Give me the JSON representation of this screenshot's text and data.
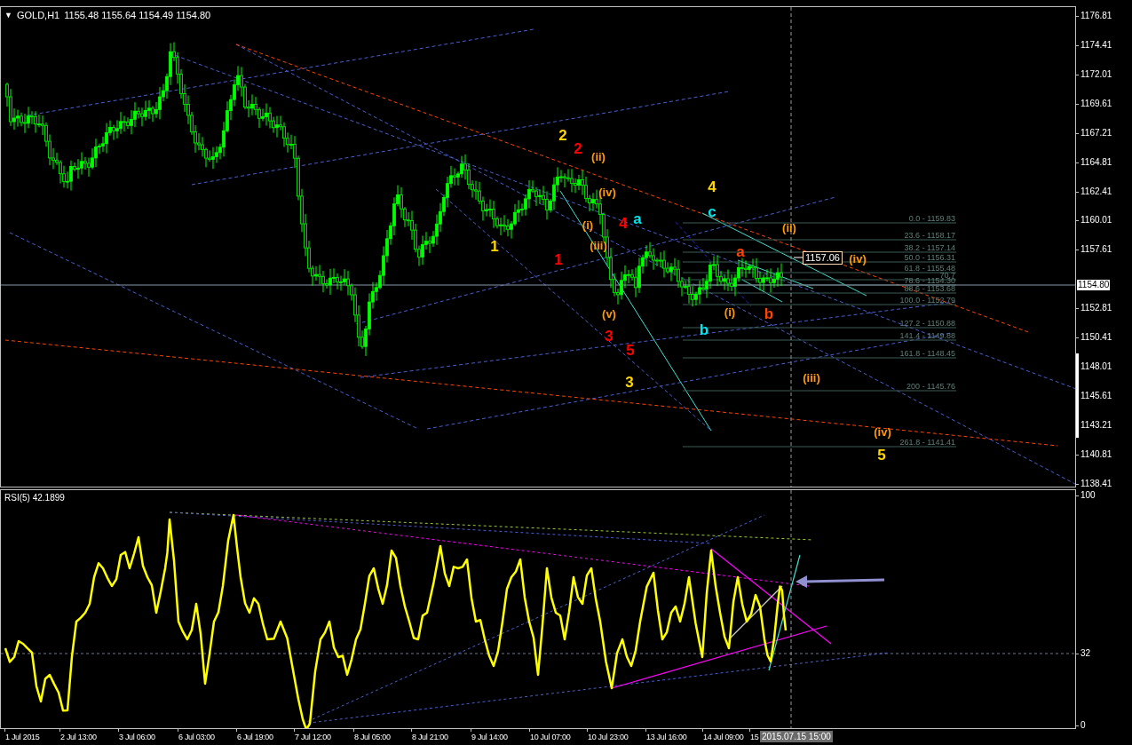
{
  "header": {
    "menu_glyph": "▼",
    "symbol": "GOLD,H1",
    "quote": "1155.48 1155.64 1154.49 1154.80"
  },
  "price_axis": {
    "ticks": [
      "1176.81",
      "1174.41",
      "1172.01",
      "1169.61",
      "1167.21",
      "1164.81",
      "1162.41",
      "1160.01",
      "1157.61",
      "1152.81",
      "1150.41",
      "1148.01",
      "1145.61",
      "1143.21",
      "1140.81",
      "1138.41"
    ],
    "current_price": "1154.80"
  },
  "price_marker": "1157.06",
  "fib_levels": [
    {
      "label": "0.0 - 1159.83"
    },
    {
      "label": "23.6 - 1158.17"
    },
    {
      "label": "38.2 - 1157.14"
    },
    {
      "label": "50.0 - 1156.31"
    },
    {
      "label": "61.8 - 1155.48"
    },
    {
      "label": "70.7"
    },
    {
      "label": "78.6 - 1154.30"
    },
    {
      "label": "88.6 - 1153.68"
    },
    {
      "label": "100.0 - 1152.79"
    },
    {
      "label": "127.2 - 1150.88"
    },
    {
      "label": "141.4 - 1149.88"
    },
    {
      "label": "161.8 - 1148.45"
    },
    {
      "label": "200 - 1145.76"
    },
    {
      "label": "261.8 - 1141.41"
    }
  ],
  "wave_labels": [
    {
      "text": "2",
      "color": "#ffd700"
    },
    {
      "text": "2",
      "color": "#ff0000"
    },
    {
      "text": "(ii)",
      "color": "#ff9900"
    },
    {
      "text": "(iv)",
      "color": "#ff9900"
    },
    {
      "text": "(i)",
      "color": "#ff9900"
    },
    {
      "text": "(iii)",
      "color": "#ff9900"
    },
    {
      "text": "4",
      "color": "#ff0000"
    },
    {
      "text": "a",
      "color": "#00e5ee"
    },
    {
      "text": "1",
      "color": "#ffd700"
    },
    {
      "text": "1",
      "color": "#ff0000"
    },
    {
      "text": "(v)",
      "color": "#ff9900"
    },
    {
      "text": "3",
      "color": "#ff0000"
    },
    {
      "text": "5",
      "color": "#ff0000"
    },
    {
      "text": "3",
      "color": "#ffd700"
    },
    {
      "text": "4",
      "color": "#ffd700"
    },
    {
      "text": "c",
      "color": "#00e5ee"
    },
    {
      "text": "b",
      "color": "#00e5ee"
    },
    {
      "text": "(i)",
      "color": "#ff9900"
    },
    {
      "text": "a",
      "color": "#ff4500"
    },
    {
      "text": "b",
      "color": "#ff4500"
    },
    {
      "text": "(ii)",
      "color": "#ff9900"
    },
    {
      "text": "(iv)",
      "color": "#ff9900"
    },
    {
      "text": "(iii)",
      "color": "#ff9900"
    },
    {
      "text": "(iv)",
      "color": "#ff9900"
    },
    {
      "text": "5",
      "color": "#ffd700"
    }
  ],
  "rsi": {
    "label": "RSI(5) 42.1899",
    "ticks": [
      "100",
      "32",
      "0"
    ]
  },
  "time_axis": {
    "labels": [
      "1 Jul 2015",
      "2 Jul 13:00",
      "3 Jul 06:00",
      "6 Jul 03:00",
      "6 Jul 19:00",
      "7 Jul 12:00",
      "8 Jul 05:00",
      "8 Jul 21:00",
      "9 Jul 14:00",
      "10 Jul 07:00",
      "10 Jul 23:00",
      "13 Jul 16:00",
      "14 Jul 09:00",
      "15"
    ],
    "cursor_time": "2015.07.15 15:00"
  }
}
